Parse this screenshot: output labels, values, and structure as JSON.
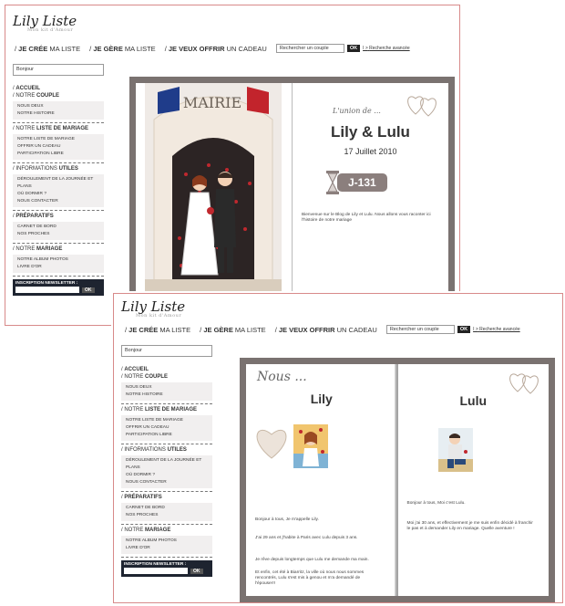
{
  "brand": {
    "logo_text": "Lily Liste",
    "tagline": "Mon kit d'Amour"
  },
  "topnav": {
    "items": [
      {
        "prefix": "/ ",
        "bold": "JE CRÉE",
        "rest": " MA LISTE"
      },
      {
        "prefix": "/ ",
        "bold": "JE GÈRE",
        "rest": " MA LISTE"
      },
      {
        "prefix": "/ ",
        "bold": "JE VEUX OFFRIR",
        "rest": " UN CADEAU"
      }
    ],
    "search_placeholder": "Rechercher un couple",
    "search_button": "OK",
    "advanced_link": "Recherche avancée",
    "separator": "I >"
  },
  "sidebar": {
    "input_value": "Bonjour",
    "sections": [
      {
        "heading_lines": [
          {
            "prefix": "/ ",
            "bold": "ACCUEIL",
            "rest": ""
          },
          {
            "prefix": "/ NOTRE ",
            "bold": "COUPLE",
            "rest": ""
          }
        ],
        "links": [
          "NOUS DEUX",
          "NOTRE HISTOIRE"
        ]
      },
      {
        "heading_lines": [
          {
            "prefix": "/ NOTRE ",
            "bold": "LISTE DE MARIAGE",
            "rest": ""
          }
        ],
        "links": [
          "NOTRE LISTE DE MARIAGE",
          "OFFRIR UN CADEAU",
          "PARTICIPATION LIBRE"
        ]
      },
      {
        "heading_lines": [
          {
            "prefix": "/ INFORMATIONS ",
            "bold": "UTILES",
            "rest": ""
          }
        ],
        "links": [
          "DÉROULEMENT DE LA JOURNÉE ET PLANS",
          "OÙ DORMIR ?",
          "NOUS CONTACTER"
        ]
      },
      {
        "heading_lines": [
          {
            "prefix": "/ ",
            "bold": "PRÉPARATIFS",
            "rest": ""
          }
        ],
        "links": [
          "CARNET DE BORD",
          "NOS PROCHES"
        ]
      },
      {
        "heading_lines": [
          {
            "prefix": "/ NOTRE ",
            "bold": "MARIAGE",
            "rest": ""
          }
        ],
        "links": [
          "NOTRE ALBUM PHOTOS",
          "LIVRE D'OR"
        ]
      }
    ],
    "newsletter_label": "INSCRIPTION NEWSLETTER :",
    "newsletter_button": "OK"
  },
  "book_a": {
    "mairie_sign": "MAIRIE",
    "script_heading": "L'union de ...",
    "couple_names": "Lily & Lulu",
    "date": "17 Juillet 2010",
    "countdown": "J-131",
    "welcome_text": "Bienvenue sur le Blog de Lily et Lulu. Nous allons vous raconter ici l'histoire de notre mariage"
  },
  "book_b": {
    "script_heading": "Nous ...",
    "left_name": "Lily",
    "right_name": "Lulu",
    "left_text_1": "Bonjour à tous, Je m'appelle Lily.",
    "left_text_2": "J'ai 29 ans et j'habite à Paris avec Lulu depuis 3 ans.",
    "left_text_3": "Je rêve depuis longtemps que Lulu me demande ma main.",
    "left_text_4": "Et enfin, cet été à Biarritz, la ville où nous nous sommes rencontrés, Lulu s'est mis à genou et m'a demandé de l'épouser!!",
    "right_text_1": "Bonjour à tous, Moi c'est Lulu.",
    "right_text_2": "Moi j'ai 30 ans, et effectivement je me suis enfin décidé à franchir le pas et à demander Lily en mariage. Quelle aventure !"
  },
  "colors": {
    "frame_border": "#d88a8a",
    "book_frame": "#7a7270",
    "sidebar_list_bg": "#f1efef",
    "newsletter_bg": "#1e2430",
    "countdown_bg": "#8b7f7d"
  }
}
